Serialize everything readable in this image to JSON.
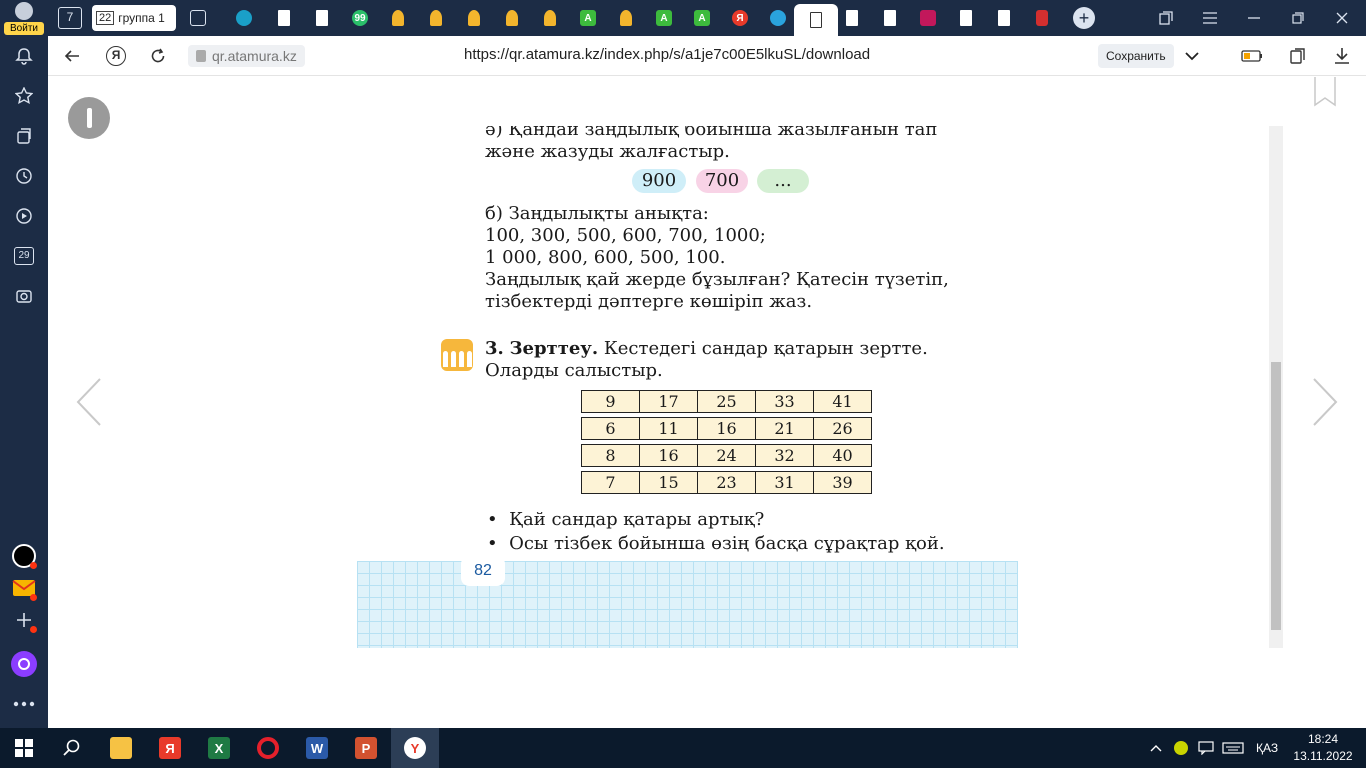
{
  "sidebar": {
    "login_label": "Войти",
    "calendar_day": "29"
  },
  "tabs": {
    "workspace_count": "7",
    "group_count": "22",
    "group_name": "группа 1"
  },
  "addressbar": {
    "domain": "qr.atamura.kz",
    "url": "https://qr.atamura.kz/index.php/s/a1je7c00E5lkuSL/download",
    "save_label": "Сохранить"
  },
  "page": {
    "line_a1": "ә) Қандай заңдылық бойынша жазылғанын тап",
    "line_a2": "және жазуды жалғастыр.",
    "pill1": "900",
    "pill2": "700",
    "pill3": "...",
    "line_b1": "б) Заңдылықты анықта:",
    "line_b2": "100, 300, 500, 600, 700, 1000;",
    "line_b3": "1 000, 800, 600, 500, 100.",
    "line_b4": "Заңдылық қай жерде бұзылған? Қатесін түзетіп,",
    "line_b5": "тізбектерді дәптерге көшіріп жаз.",
    "task3_num": "3.",
    "task3_title": "Зерттеу.",
    "task3_rest": "Кестедегі сандар қатарын зертте.",
    "task3_line2": "Оларды салыстыр.",
    "table": [
      [
        "9",
        "17",
        "25",
        "33",
        "41"
      ],
      [
        "6",
        "11",
        "16",
        "21",
        "26"
      ],
      [
        "8",
        "16",
        "24",
        "32",
        "40"
      ],
      [
        "7",
        "15",
        "23",
        "31",
        "39"
      ]
    ],
    "bullet1": "Қай сандар қатары артық?",
    "bullet2": "Осы тізбек бойынша өзің басқа сұрақтар қой.",
    "page_number": "82"
  },
  "taskbar": {
    "language": "ҚАЗ",
    "time": "18:24",
    "date": "13.11.2022"
  }
}
